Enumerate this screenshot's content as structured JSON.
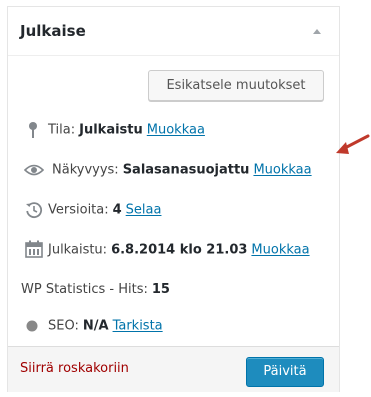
{
  "box": {
    "title": "Julkaise"
  },
  "preview_button": "Esikatsele muutokset",
  "status": {
    "label": "Tila:",
    "value": "Julkaistu",
    "edit": "Muokkaa"
  },
  "visibility": {
    "label": "Näkyvyys:",
    "value": "Salasanasuojattu",
    "edit": "Muokkaa"
  },
  "revisions": {
    "label": "Versioita:",
    "value": "4",
    "browse": "Selaa"
  },
  "published": {
    "label": "Julkaistu:",
    "value": "6.8.2014 klo 21.03",
    "edit": "Muokkaa"
  },
  "stats": {
    "label": "WP Statistics - Hits:",
    "value": "15"
  },
  "seo": {
    "label": "SEO:",
    "value": "N/A",
    "check": "Tarkista"
  },
  "footer": {
    "trash": "Siirrä roskakoriin",
    "update": "Päivitä"
  },
  "colors": {
    "link": "#0073aa",
    "trash": "#a00000",
    "primary_button": "#1e8cbe",
    "annotation_arrow": "#c0392b"
  }
}
